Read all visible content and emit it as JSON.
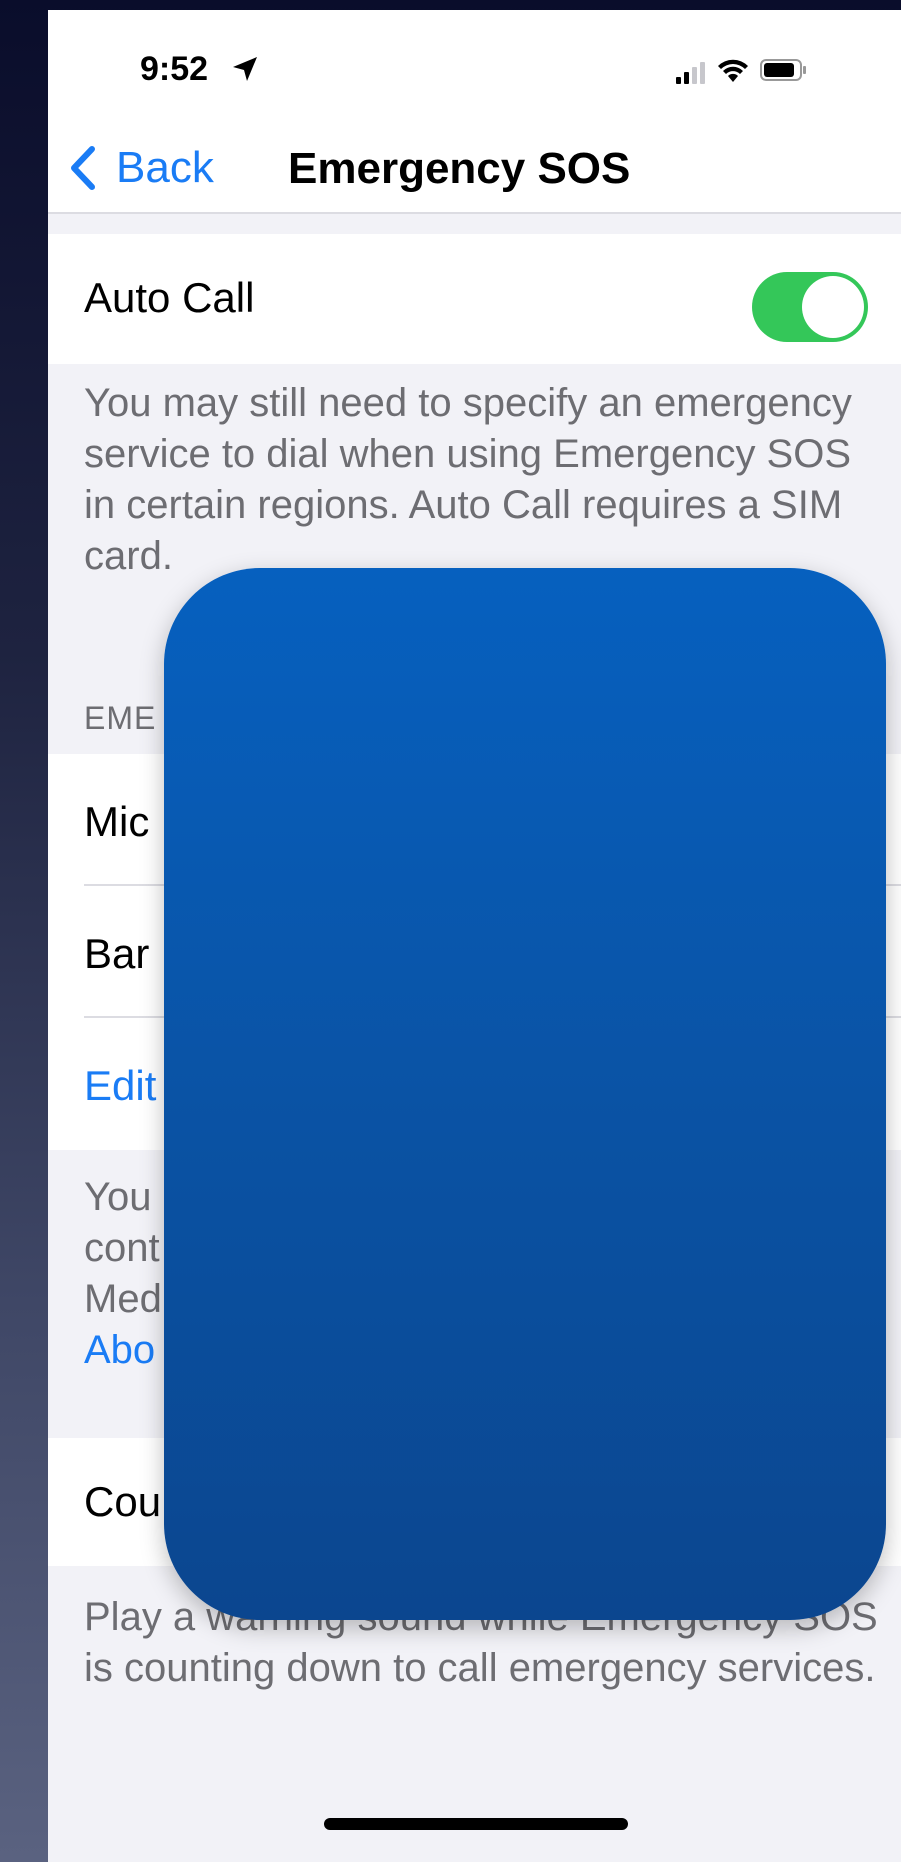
{
  "status_bar": {
    "time": "9:52"
  },
  "nav": {
    "back_label": "Back",
    "title": "Emergency SOS"
  },
  "auto_call": {
    "label": "Auto Call",
    "toggle_on": true,
    "footer": "You may still need to specify an emergency service to dial when using Emergency SOS in certain regions. Auto Call requires a SIM card."
  },
  "emergency_contacts": {
    "section_header": "EME",
    "items": [
      {
        "label": "Mic"
      },
      {
        "label": "Bar"
      }
    ],
    "edit_label": "Edit",
    "footer_lines": [
      "You",
      "cont",
      "Med"
    ],
    "footer_link": "Abo"
  },
  "countdown_sound": {
    "label": "Cou",
    "footer": "Play a warning sound while Emergency SOS is counting down to call emergency services."
  },
  "colors": {
    "accent": "#1a7cf5",
    "toggle_on": "#34c759",
    "overlay": "#0a53a5"
  },
  "icons": {
    "location": "location-arrow-icon",
    "signal": "cellular-signal-icon",
    "wifi": "wifi-icon",
    "battery": "battery-icon",
    "back": "chevron-left-icon"
  }
}
